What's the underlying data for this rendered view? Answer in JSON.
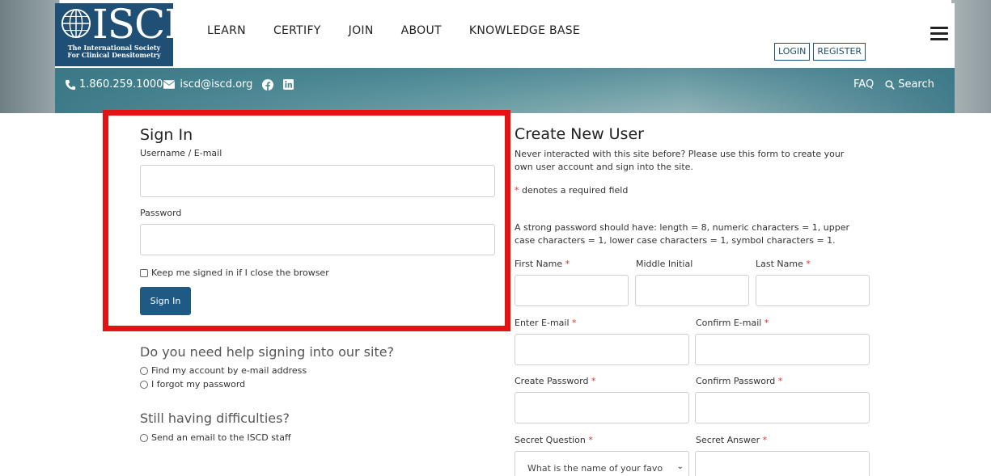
{
  "header": {
    "logo_text": "ISCD",
    "logo_sub_line1": "The International Society",
    "logo_sub_line2": "For Clinical Densitometry",
    "nav": [
      "LEARN",
      "CERTIFY",
      "JOIN",
      "ABOUT",
      "KNOWLEDGE BASE"
    ],
    "login_label": "LOGIN",
    "register_label": "REGISTER",
    "phone": "1.860.259.1000",
    "email": "iscd@iscd.org",
    "faq_label": "FAQ",
    "search_label": "Search"
  },
  "signin": {
    "title": "Sign In",
    "username_label": "Username / E-mail",
    "password_label": "Password",
    "keep_signed_label": "Keep me signed in if I close the browser",
    "button_label": "Sign In"
  },
  "help": {
    "title": "Do you need help signing into our site?",
    "option1": "Find my account by e-mail address",
    "option2": "I forgot my password",
    "still_title": "Still having difficulties?",
    "option3": "Send an email to the ISCD staff"
  },
  "create": {
    "title": "Create New User",
    "intro": "Never interacted with this site before? Please use this form to create your own user account and sign into the site.",
    "required_mark": "*",
    "required_note": " denotes a required field",
    "password_hint": "A strong password should have: length = 8, numeric characters = 1, upper case characters = 1, lower case characters = 1, symbol characters = 1.",
    "first_name": "First Name",
    "middle_initial": "Middle Initial",
    "last_name": "Last Name",
    "enter_email": "Enter E-mail",
    "confirm_email": "Confirm E-mail",
    "create_password": "Create Password",
    "confirm_password": "Confirm Password",
    "secret_question": "Secret Question",
    "secret_answer": "Secret Answer",
    "secret_question_value": "What is the name of your favo"
  },
  "colors": {
    "brand_blue": "#1f4f74",
    "button_blue": "#1f5a85",
    "highlight_red": "#e31313",
    "required_red": "#d33333"
  }
}
